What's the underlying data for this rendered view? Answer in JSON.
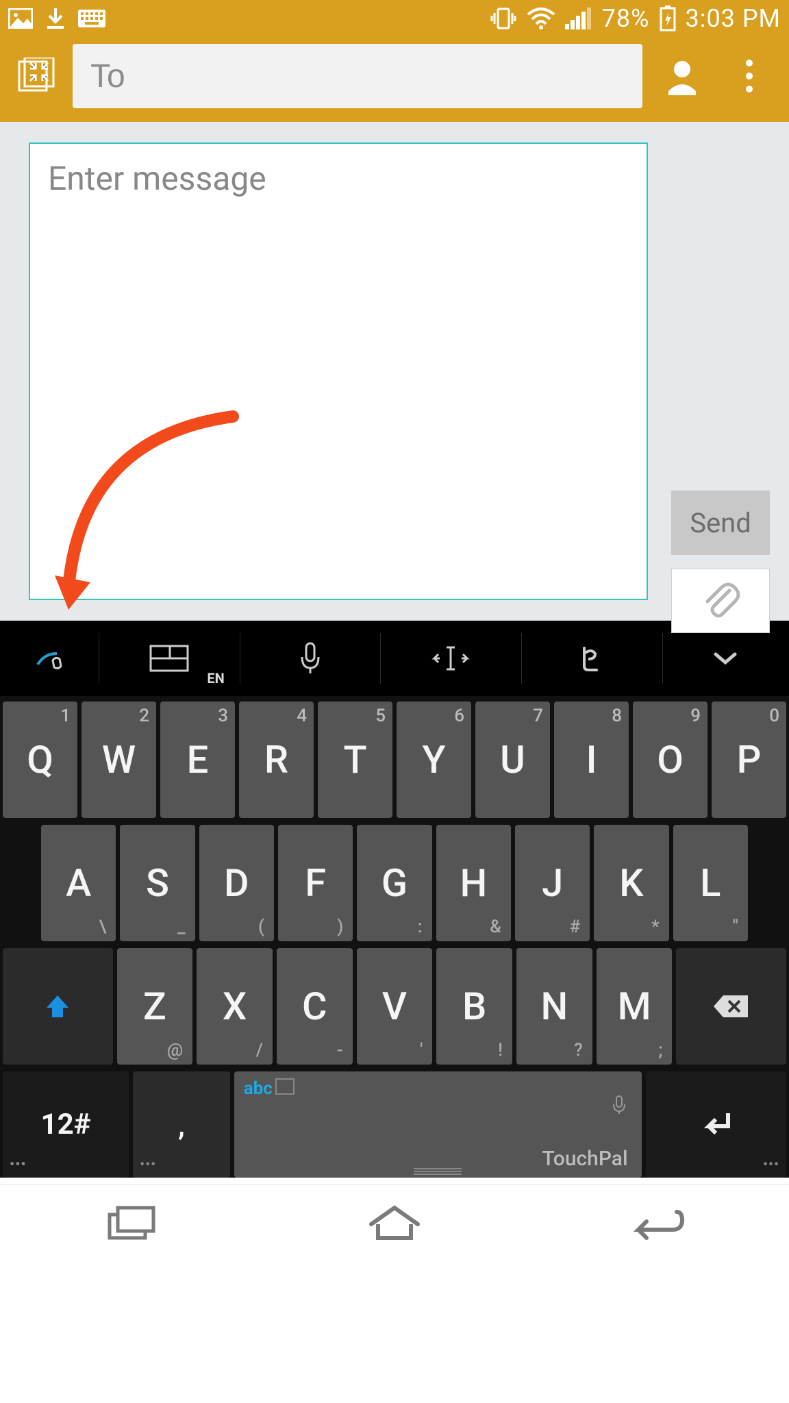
{
  "status": {
    "battery": "78%",
    "time": "3:03 PM"
  },
  "appbar": {
    "to_placeholder": "To"
  },
  "compose": {
    "message_placeholder": "Enter message",
    "send_label": "Send"
  },
  "kb_toolbar": {
    "lang_badge": "EN"
  },
  "keyboard": {
    "row1": [
      {
        "main": "Q",
        "num": "1"
      },
      {
        "main": "W",
        "num": "2"
      },
      {
        "main": "E",
        "num": "3"
      },
      {
        "main": "R",
        "num": "4"
      },
      {
        "main": "T",
        "num": "5"
      },
      {
        "main": "Y",
        "num": "6"
      },
      {
        "main": "U",
        "num": "7"
      },
      {
        "main": "I",
        "num": "8"
      },
      {
        "main": "O",
        "num": "9"
      },
      {
        "main": "P",
        "num": "0"
      }
    ],
    "row2": [
      {
        "main": "A",
        "sym": "\\"
      },
      {
        "main": "S",
        "sym": "_"
      },
      {
        "main": "D",
        "sym": "("
      },
      {
        "main": "F",
        "sym": ")"
      },
      {
        "main": "G",
        "sym": ":"
      },
      {
        "main": "H",
        "sym": "&"
      },
      {
        "main": "J",
        "sym": "#"
      },
      {
        "main": "K",
        "sym": "*"
      },
      {
        "main": "L",
        "sym": "\""
      }
    ],
    "row3": [
      {
        "main": "Z",
        "sym": "@"
      },
      {
        "main": "X",
        "sym": "/"
      },
      {
        "main": "C",
        "sym": "-"
      },
      {
        "main": "V",
        "sym": "'"
      },
      {
        "main": "B",
        "sym": "!"
      },
      {
        "main": "N",
        "sym": "?"
      },
      {
        "main": "M",
        "sym": ";"
      }
    ],
    "mode_label": "12#",
    "comma_label": ",",
    "space_abc": "abc",
    "space_brand": "TouchPal"
  }
}
